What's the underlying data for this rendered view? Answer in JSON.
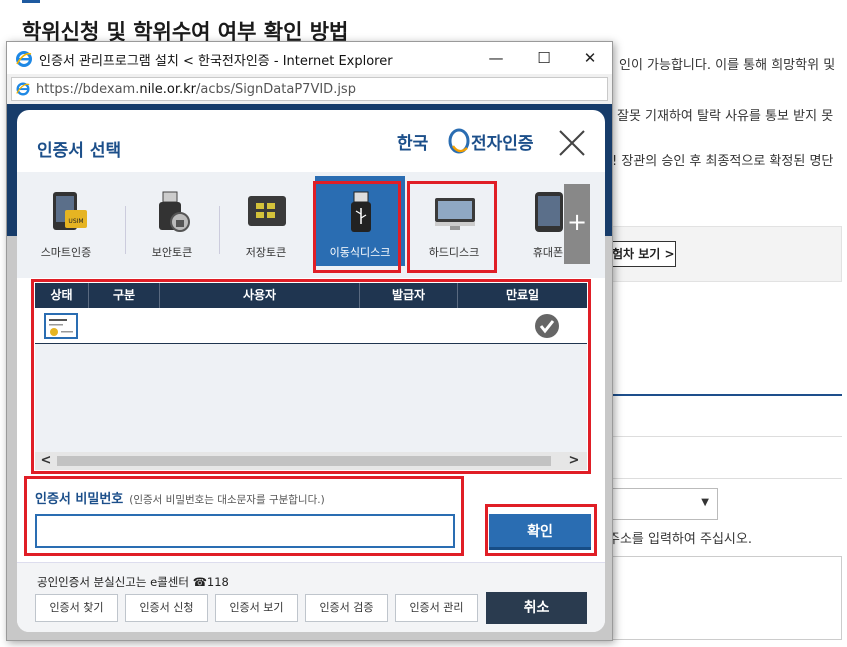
{
  "background": {
    "title": "학위신청 및 학위수여 여부 확인 방법",
    "lines": [
      "인이 가능합니다. 이를 통해 희망학위 및",
      "잘못 기재하여 탈락 사유를 통보 받지 못",
      "! 장관의 승인 후 최종적으로 확정된 명단"
    ],
    "detail_button": "험차 보기 >",
    "address_hint": "주소를 입력하여 주십시오."
  },
  "ie": {
    "title": "인증서 관리프로그램 설치 < 한국전자인증 - Internet Explorer",
    "url_prefix": "https://bdexam.",
    "url_domain": "nile.or.kr",
    "url_path": "/acbs/SignDataP7VID.jsp",
    "minimize_glyph": "—",
    "maximize_glyph": "☐",
    "close_glyph": "✕"
  },
  "dialog": {
    "title": "인증서 선택",
    "brand": "한국전자인증",
    "media": [
      {
        "label": "스마트인증"
      },
      {
        "label": "보안토큰"
      },
      {
        "label": "저장토큰"
      },
      {
        "label": "이동식디스크"
      },
      {
        "label": "하드디스크"
      },
      {
        "label": "휴대폰"
      }
    ],
    "more_glyph": "+",
    "table": {
      "headers": [
        "상태",
        "구분",
        "사용자",
        "발급자",
        "만료일"
      ],
      "scroll_left": "<",
      "scroll_right": ">"
    },
    "password": {
      "label": "인증서 비밀번호",
      "hint": "(인증서 비밀번호는 대소문자를 구분합니다.)",
      "value": ""
    },
    "confirm": "확인",
    "lost_note": "공인인증서 분실신고는 e콜센터 ☎118",
    "footer_buttons": [
      "인증서 찾기",
      "인증서 신청",
      "인증서 보기",
      "인증서 검증",
      "인증서 관리"
    ],
    "cancel": "취소"
  },
  "colors": {
    "accent": "#2a6db2",
    "highlight": "#e01e26",
    "header": "#1f3550"
  }
}
